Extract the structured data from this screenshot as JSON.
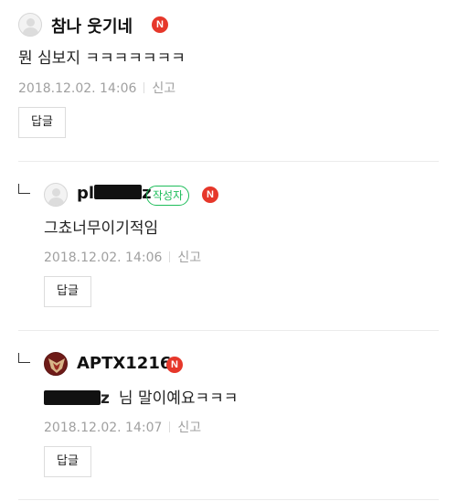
{
  "comments": [
    {
      "nickname": "참나 웃기네",
      "badge": "N",
      "text": "뭔 심보지 ㅋㅋㅋㅋㅋㅋㅋ",
      "date": "2018.12.02. 14:06",
      "report": "신고",
      "reply": "답글"
    },
    {
      "nickname_visible_start": "pl",
      "nickname_visible_end": "z",
      "writer_badge": "작성자",
      "badge": "N",
      "text": "그쵸너무이기적임",
      "date": "2018.12.02. 14:06",
      "report": "신고",
      "reply": "답글"
    },
    {
      "nickname": "APTX1216",
      "badge": "N",
      "mention_visible_end": "z",
      "text": "님 말이예요ㅋㅋㅋ",
      "date": "2018.12.02. 14:07",
      "report": "신고",
      "reply": "답글"
    }
  ],
  "icons": {
    "default_avatar": "person-silhouette-icon",
    "reply_indicator": "reply-arrow-icon",
    "new_badge": "new-badge-icon"
  },
  "colors": {
    "new_badge": "#e6372a",
    "writer_badge": "#1ebd5a",
    "meta_text": "#a0a0a0"
  }
}
